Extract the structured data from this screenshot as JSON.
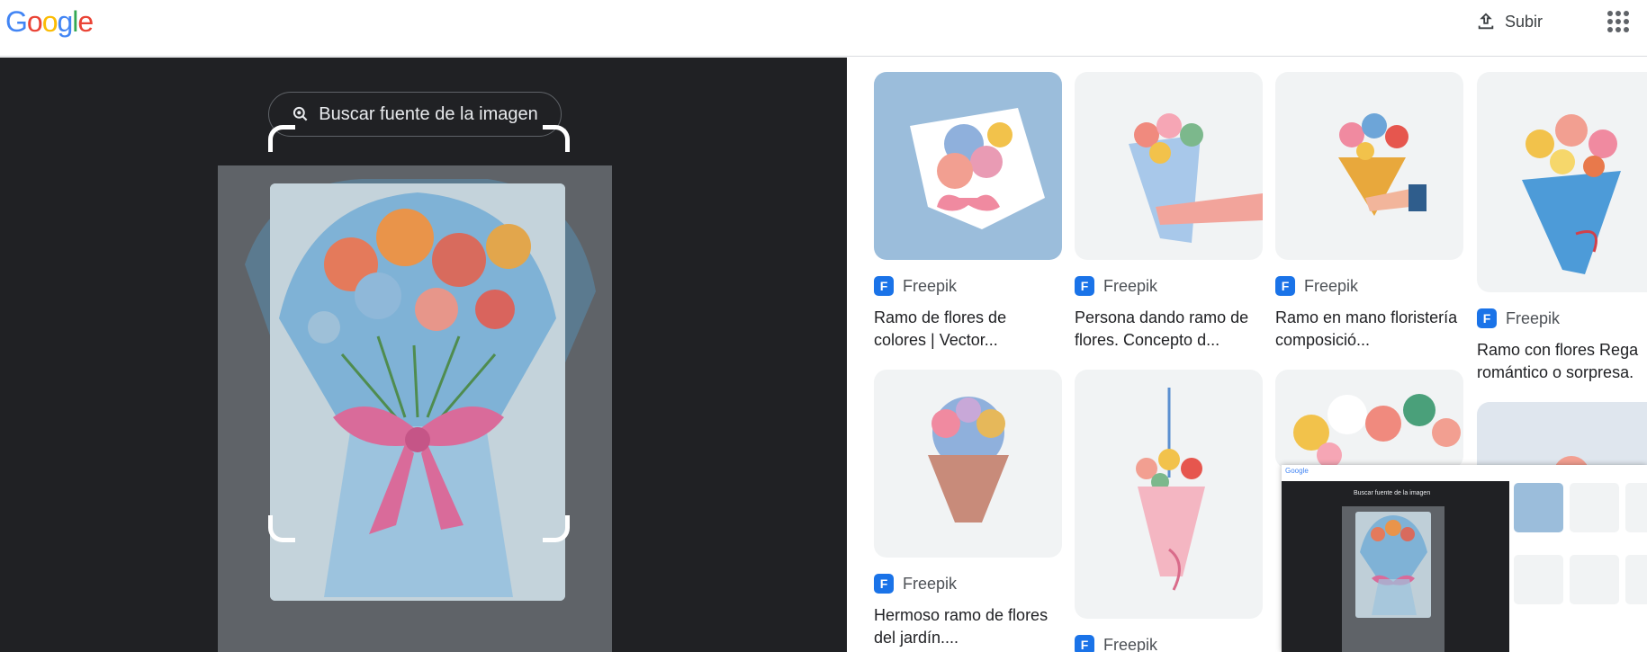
{
  "header": {
    "logo": [
      "G",
      "o",
      "o",
      "g",
      "l",
      "e"
    ],
    "logo_colors": [
      "#4285F4",
      "#EA4335",
      "#FBBC05",
      "#4285F4",
      "#34A853",
      "#EA4335"
    ],
    "upload_label": "Subir",
    "upload_icon": "upload-icon",
    "apps_icon": "apps-grid-icon"
  },
  "lens": {
    "source_button_label": "Buscar fuente de la imagen",
    "source_button_icon": "lens-search-icon"
  },
  "results": [
    {
      "source": "Freepik",
      "title": "Ramo de flores de colores | Vector..."
    },
    {
      "source": "Freepik",
      "title": "Persona dando ramo de flores. Concepto d..."
    },
    {
      "source": "Freepik",
      "title": "Ramo en mano floristería composició..."
    },
    {
      "source": "Freepik",
      "title": "Ramo con flores Rega romántico o sorpresa."
    },
    {
      "source": "Freepik",
      "title": "Hermoso ramo de flores del jardín...."
    },
    {
      "source": "Freepik",
      "title": ""
    },
    {
      "source": "",
      "title": ""
    },
    {
      "source": "",
      "title": ""
    }
  ],
  "mini_preview": {
    "logo": "Google",
    "source_button_label": "Buscar fuente de la imagen"
  },
  "colors": {
    "accent": "#1a73e8",
    "dark_panel": "#202124"
  }
}
